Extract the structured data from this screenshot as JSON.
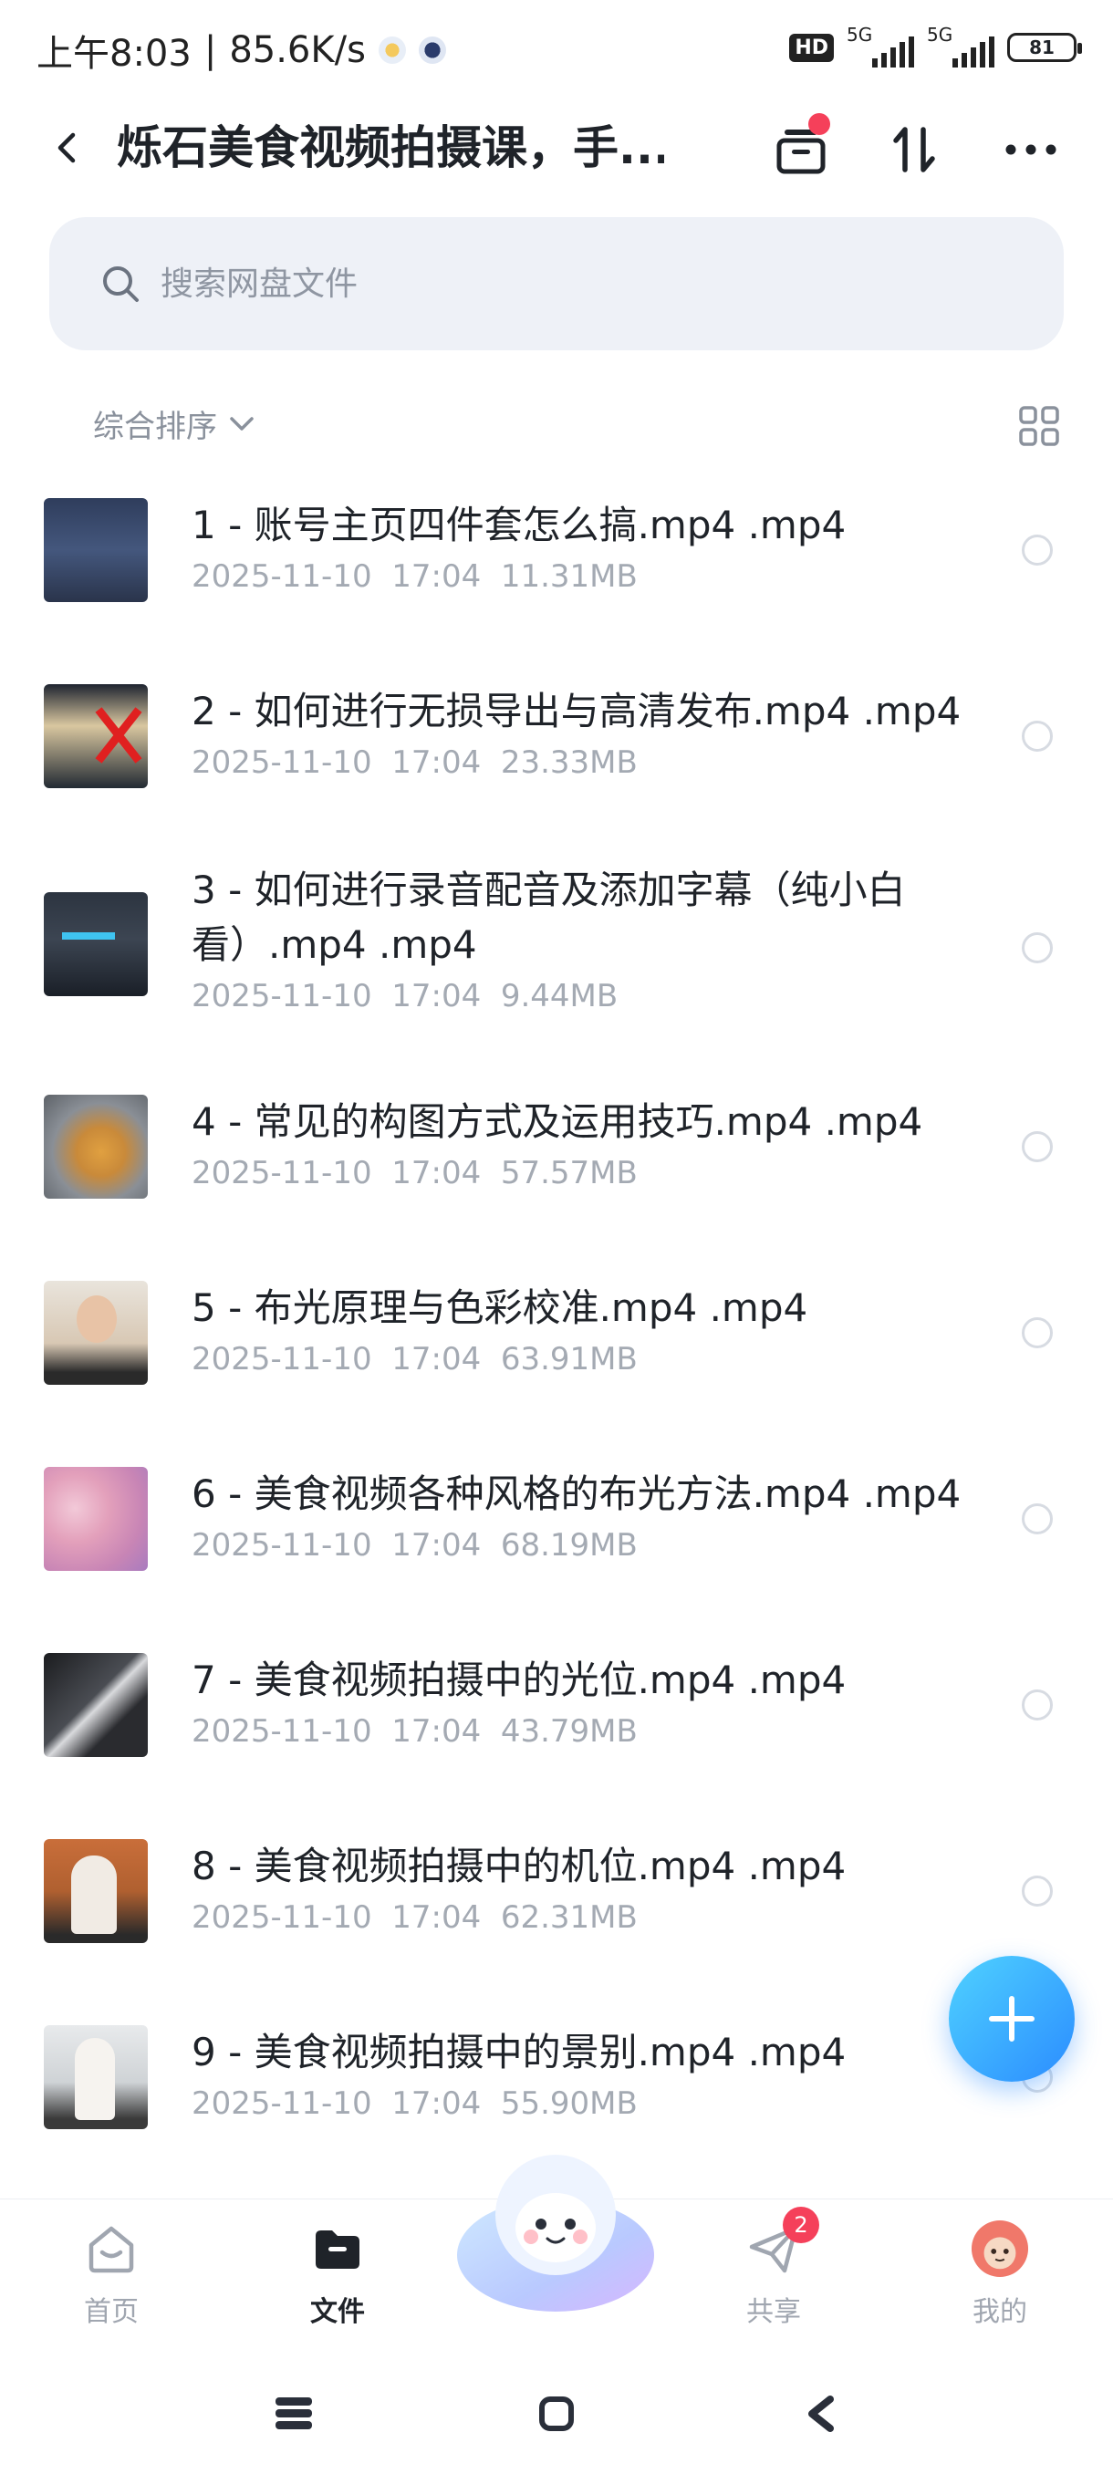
{
  "status_bar": {
    "time": "上午8:03",
    "separator": "|",
    "net_speed": "85.6K/s",
    "hd_label": "HD",
    "sim1_label": "5G",
    "sim2_label": "5G",
    "battery": "81"
  },
  "header": {
    "title": "烁石美食视频拍摄课，手..."
  },
  "search": {
    "placeholder": "搜索网盘文件"
  },
  "sort": {
    "label": "综合排序"
  },
  "files": [
    {
      "name": "1 - 账号主页四件套怎么搞.mp4 .mp4",
      "date": "2025-11-10",
      "time": "17:04",
      "size": "11.31MB"
    },
    {
      "name": "2 - 如何进行无损导出与高清发布.mp4 .mp4",
      "date": "2025-11-10",
      "time": "17:04",
      "size": "23.33MB"
    },
    {
      "name": "3 - 如何进行录音配音及添加字幕（纯小白看）.mp4 .mp4",
      "date": "2025-11-10",
      "time": "17:04",
      "size": "9.44MB"
    },
    {
      "name": "4 - 常见的构图方式及运用技巧.mp4 .mp4",
      "date": "2025-11-10",
      "time": "17:04",
      "size": "57.57MB"
    },
    {
      "name": "5 - 布光原理与色彩校准.mp4 .mp4",
      "date": "2025-11-10",
      "time": "17:04",
      "size": "63.91MB"
    },
    {
      "name": "6 - 美食视频各种风格的布光方法.mp4 .mp4",
      "date": "2025-11-10",
      "time": "17:04",
      "size": "68.19MB"
    },
    {
      "name": "7 - 美食视频拍摄中的光位.mp4 .mp4",
      "date": "2025-11-10",
      "time": "17:04",
      "size": "43.79MB"
    },
    {
      "name": "8 - 美食视频拍摄中的机位.mp4 .mp4",
      "date": "2025-11-10",
      "time": "17:04",
      "size": "62.31MB"
    },
    {
      "name": "9 - 美食视频拍摄中的景别.mp4 .mp4",
      "date": "2025-11-10",
      "time": "17:04",
      "size": "55.90MB"
    }
  ],
  "bottom_nav": {
    "home": "首页",
    "files": "文件",
    "share": "共享",
    "share_badge": "2",
    "me": "我的"
  },
  "colors": {
    "accent": "#2b8cff",
    "badge": "#f5405a",
    "search_bg": "#eef1f7"
  }
}
